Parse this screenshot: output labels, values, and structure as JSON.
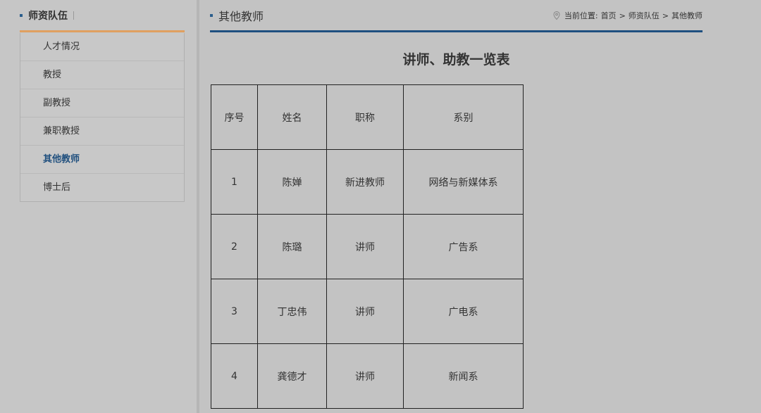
{
  "sidebar": {
    "title": "师资队伍",
    "items": [
      {
        "label": "人才情况"
      },
      {
        "label": "教授"
      },
      {
        "label": "副教授"
      },
      {
        "label": "兼职教授"
      },
      {
        "label": "其他教师"
      },
      {
        "label": "博士后"
      }
    ],
    "active_index": 4
  },
  "main": {
    "title": "其他教师",
    "breadcrumb": {
      "prefix": "当前位置:",
      "items": [
        "首页",
        "师资队伍",
        "其他教师"
      ],
      "separator": ">"
    },
    "table_title": "讲师、助教一览表",
    "table": {
      "headers": [
        "序号",
        "姓名",
        "职称",
        "系别"
      ],
      "rows": [
        [
          "1",
          "陈婵",
          "新进教师",
          "网络与新媒体系"
        ],
        [
          "2",
          "陈璐",
          "讲师",
          "广告系"
        ],
        [
          "3",
          "丁忠伟",
          "讲师",
          "广电系"
        ],
        [
          "4",
          "龚德才",
          "讲师",
          "新闻系"
        ]
      ]
    }
  },
  "colors": {
    "background": "#c3c3c3",
    "accent_orange": "#e0a060",
    "accent_blue": "#1f5080",
    "active_link": "#1f4f7e"
  },
  "icons": {
    "breadcrumb": "location-pin-icon"
  }
}
